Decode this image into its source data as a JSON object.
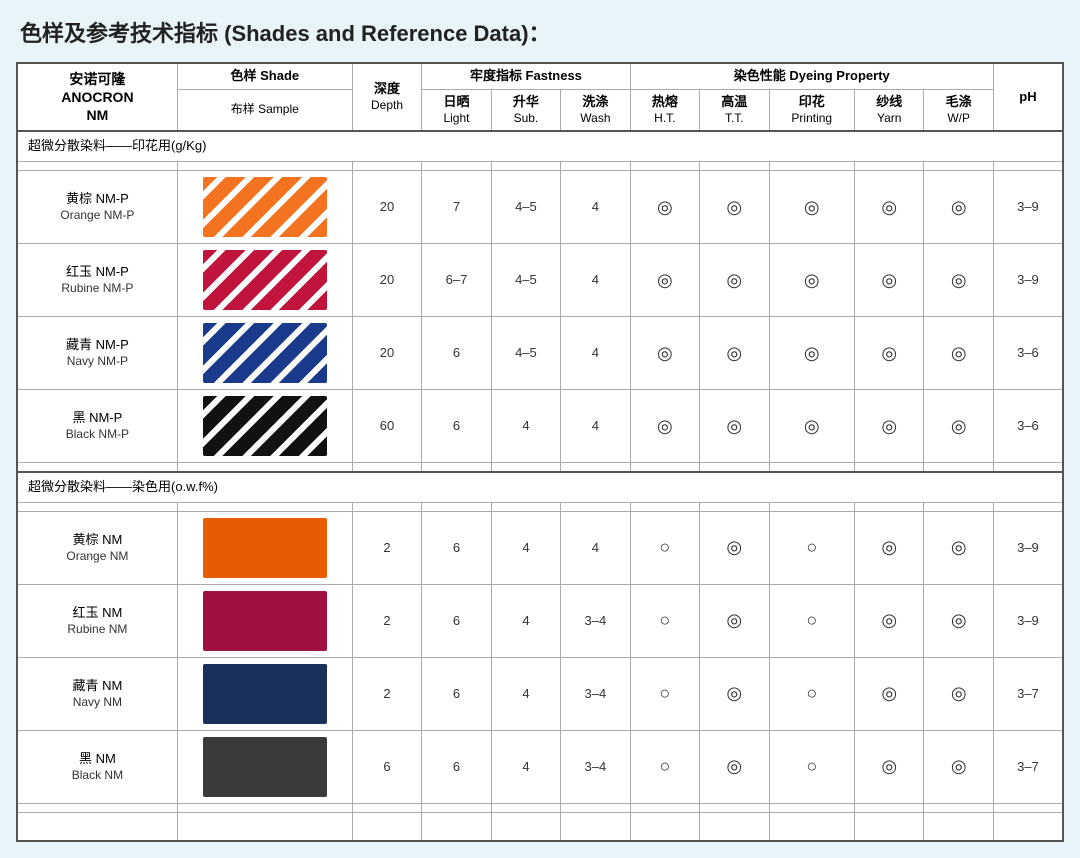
{
  "title": "色样及参考技术指标 (Shades and Reference Data)：",
  "headers": {
    "product": [
      "安诺可隆",
      "ANOCRON",
      "NM"
    ],
    "shade": "色样 Shade",
    "shade_sub": "布样 Sample",
    "depth": "深度",
    "depth_sub": "Depth",
    "fastness": "牢度指标 Fastness",
    "fastness_cols": [
      {
        "label": "日晒",
        "sub": "Light"
      },
      {
        "label": "升华",
        "sub": "Sub."
      },
      {
        "label": "洗涤",
        "sub": "Wash"
      }
    ],
    "dyeing": "染色性能 Dyeing Property",
    "dyeing_cols": [
      {
        "label": "热熔",
        "sub": "H.T."
      },
      {
        "label": "高温",
        "sub": "T.T."
      },
      {
        "label": "印花",
        "sub": "Printing"
      },
      {
        "label": "纱线",
        "sub": "Yarn"
      },
      {
        "label": "毛涤",
        "sub": "W/P"
      }
    ],
    "ph": "pH"
  },
  "sections": [
    {
      "label": "超微分散染料——印花用(g/Kg)",
      "rows": [
        {
          "name_cn": "黄棕 NM-P",
          "name_en": "Orange NM-P",
          "swatch_class": "sw-orange",
          "depth": "20",
          "light": "7",
          "sub": "4–5",
          "wash": "4",
          "ht": "◎",
          "tt": "◎",
          "printing": "◎",
          "yarn": "◎",
          "wp": "◎",
          "ph": "3–9"
        },
        {
          "name_cn": "红玉 NM-P",
          "name_en": "Rubine NM-P",
          "swatch_class": "sw-rubine",
          "depth": "20",
          "light": "6–7",
          "sub": "4–5",
          "wash": "4",
          "ht": "◎",
          "tt": "◎",
          "printing": "◎",
          "yarn": "◎",
          "wp": "◎",
          "ph": "3–9"
        },
        {
          "name_cn": "藏青 NM-P",
          "name_en": "Navy NM-P",
          "swatch_class": "sw-navy",
          "depth": "20",
          "light": "6",
          "sub": "4–5",
          "wash": "4",
          "ht": "◎",
          "tt": "◎",
          "printing": "◎",
          "yarn": "◎",
          "wp": "◎",
          "ph": "3–6"
        },
        {
          "name_cn": "黑 NM-P",
          "name_en": "Black NM-P",
          "swatch_class": "sw-black",
          "depth": "60",
          "light": "6",
          "sub": "4",
          "wash": "4",
          "ht": "◎",
          "tt": "◎",
          "printing": "◎",
          "yarn": "◎",
          "wp": "◎",
          "ph": "3–6"
        }
      ]
    },
    {
      "label": "超微分散染料——染色用(o.w.f%)",
      "rows": [
        {
          "name_cn": "黄棕 NM",
          "name_en": "Orange NM",
          "swatch_class": "sw-orange-nm",
          "depth": "2",
          "light": "6",
          "sub": "4",
          "wash": "4",
          "ht": "○",
          "tt": "◎",
          "printing": "○",
          "yarn": "◎",
          "wp": "◎",
          "ph": "3–9"
        },
        {
          "name_cn": "红玉 NM",
          "name_en": "Rubine NM",
          "swatch_class": "sw-rubine-nm",
          "depth": "2",
          "light": "6",
          "sub": "4",
          "wash": "3–4",
          "ht": "○",
          "tt": "◎",
          "printing": "○",
          "yarn": "◎",
          "wp": "◎",
          "ph": "3–9"
        },
        {
          "name_cn": "藏青 NM",
          "name_en": "Navy NM",
          "swatch_class": "sw-navy-nm",
          "depth": "2",
          "light": "6",
          "sub": "4",
          "wash": "3–4",
          "ht": "○",
          "tt": "◎",
          "printing": "○",
          "yarn": "◎",
          "wp": "◎",
          "ph": "3–7"
        },
        {
          "name_cn": "黑 NM",
          "name_en": "Black NM",
          "swatch_class": "sw-black-nm",
          "depth": "6",
          "light": "6",
          "sub": "4",
          "wash": "3–4",
          "ht": "○",
          "tt": "◎",
          "printing": "○",
          "yarn": "◎",
          "wp": "◎",
          "ph": "3–7"
        }
      ]
    }
  ]
}
